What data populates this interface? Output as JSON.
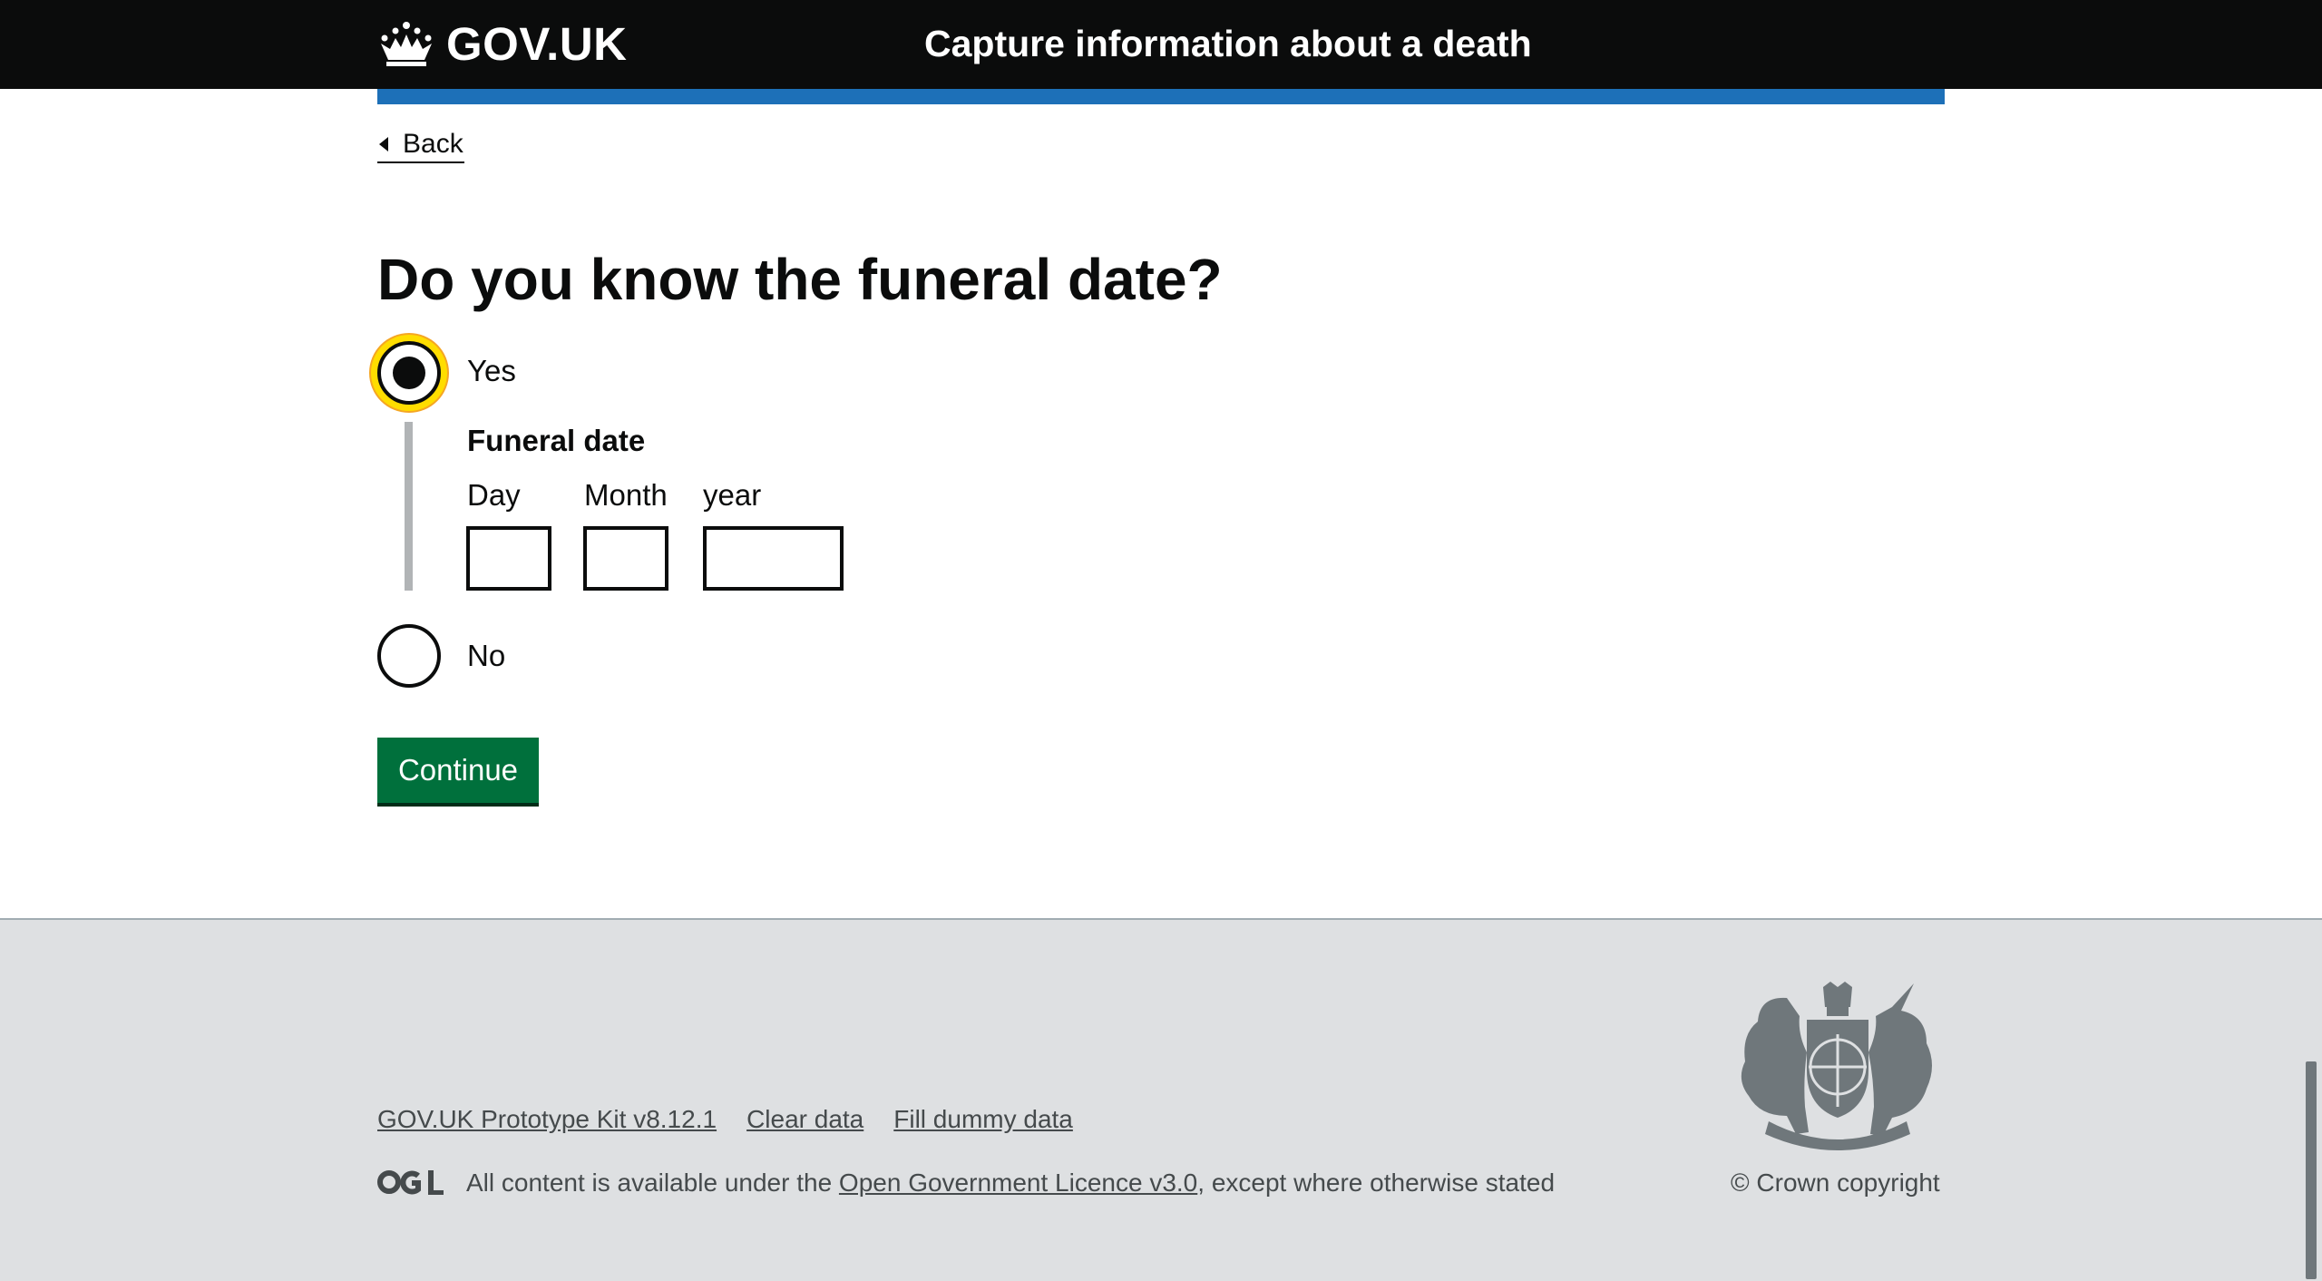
{
  "header": {
    "logo_text": "GOV.UK",
    "service_name": "Capture information about a death"
  },
  "back_link": {
    "label": "Back"
  },
  "question": {
    "heading": "Do you know the funeral date?"
  },
  "radios": {
    "yes_label": "Yes",
    "no_label": "No",
    "selected": "Yes"
  },
  "funeral_date": {
    "legend": "Funeral date",
    "day_label": "Day",
    "month_label": "Month",
    "year_label": "year",
    "day_value": "",
    "month_value": "",
    "year_value": ""
  },
  "continue_button": {
    "label": "Continue"
  },
  "footer": {
    "links": [
      "GOV.UK Prototype Kit v8.12.1",
      "Clear data",
      "Fill dummy data"
    ],
    "licence_prefix": "All content is available under the ",
    "licence_link": "Open Government Licence v3.0",
    "licence_suffix": ", except where otherwise stated",
    "copyright": "© Crown copyright"
  },
  "colors": {
    "header_bg": "#0b0c0c",
    "blue_bar": "#1d70b8",
    "button_green": "#00703c",
    "focus_yellow": "#ffdd00",
    "footer_bg": "#dee0e2"
  },
  "icons": {
    "logo": "crown-icon",
    "back": "back-arrow-icon",
    "licence": "ogl-icon",
    "crest": "royal-coat-of-arms-icon"
  }
}
